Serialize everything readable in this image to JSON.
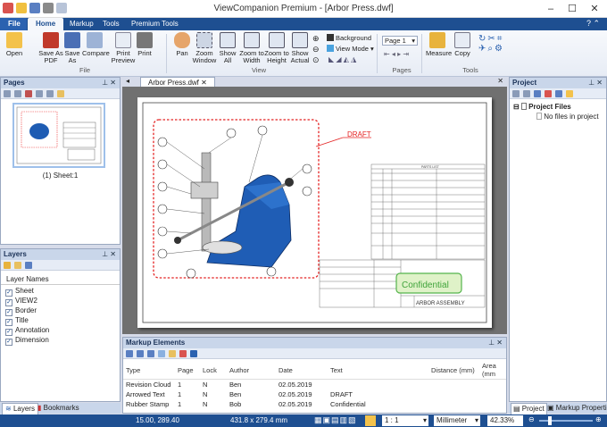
{
  "app": {
    "title": "ViewCompanion Premium - [Arbor Press.dwf]"
  },
  "tabs": [
    "File",
    "Home",
    "Markup",
    "Tools",
    "Premium Tools"
  ],
  "ribbon": {
    "file_group": [
      "Open",
      "Save As PDF",
      "Save As",
      "Compare",
      "Print Preview",
      "Print"
    ],
    "file_label": "File",
    "view_group": [
      "Pan",
      "Zoom Window",
      "Show All",
      "Zoom to Width",
      "Zoom to Height",
      "Show Actual"
    ],
    "view_options": [
      "Background",
      "View Mode"
    ],
    "view_label": "View",
    "page_select": "Page 1",
    "pages_label": "Pages",
    "tools_group": [
      "Measure",
      "Copy"
    ],
    "tools_label": "Tools"
  },
  "pages_panel": {
    "title": "Pages",
    "thumb_label": "(1) Sheet:1"
  },
  "layers_panel": {
    "title": "Layers",
    "header": "Layer Names",
    "layers": [
      "Sheet",
      "VIEW2",
      "Border",
      "Title",
      "Annotation",
      "Dimension"
    ]
  },
  "bottom_tabs": [
    "Layers",
    "Bookmarks"
  ],
  "document": {
    "tab": "Arbor Press.dwf"
  },
  "drawing": {
    "draft": "DRAFT",
    "confidential": "Confidential",
    "assembly": "ARBOR ASSEMBLY",
    "parts_list": "PARTS LIST"
  },
  "markup_panel": {
    "title": "Markup Elements",
    "columns": [
      "Type",
      "Page",
      "Lock",
      "Author",
      "Date",
      "Text",
      "Distance (mm)",
      "Area (mm"
    ],
    "rows": [
      [
        "Revision Cloud",
        "1",
        "N",
        "Ben",
        "02.05.2019",
        "",
        ""
      ],
      [
        "Arrowed Text",
        "1",
        "N",
        "Ben",
        "02.05.2019",
        "DRAFT",
        ""
      ],
      [
        "Rubber Stamp",
        "1",
        "N",
        "Bob",
        "02.05.2019",
        "Confidential",
        ""
      ]
    ]
  },
  "project_panel": {
    "title": "Project",
    "root": "Project Files",
    "empty": "No files in project"
  },
  "right_tabs": [
    "Project",
    "Markup Properties"
  ],
  "status": {
    "coords": "15.00, 289.40",
    "size": "431.8 x 279.4 mm",
    "scale": "1 : 1",
    "unit": "Millimeter",
    "zoom": "42.33%"
  }
}
